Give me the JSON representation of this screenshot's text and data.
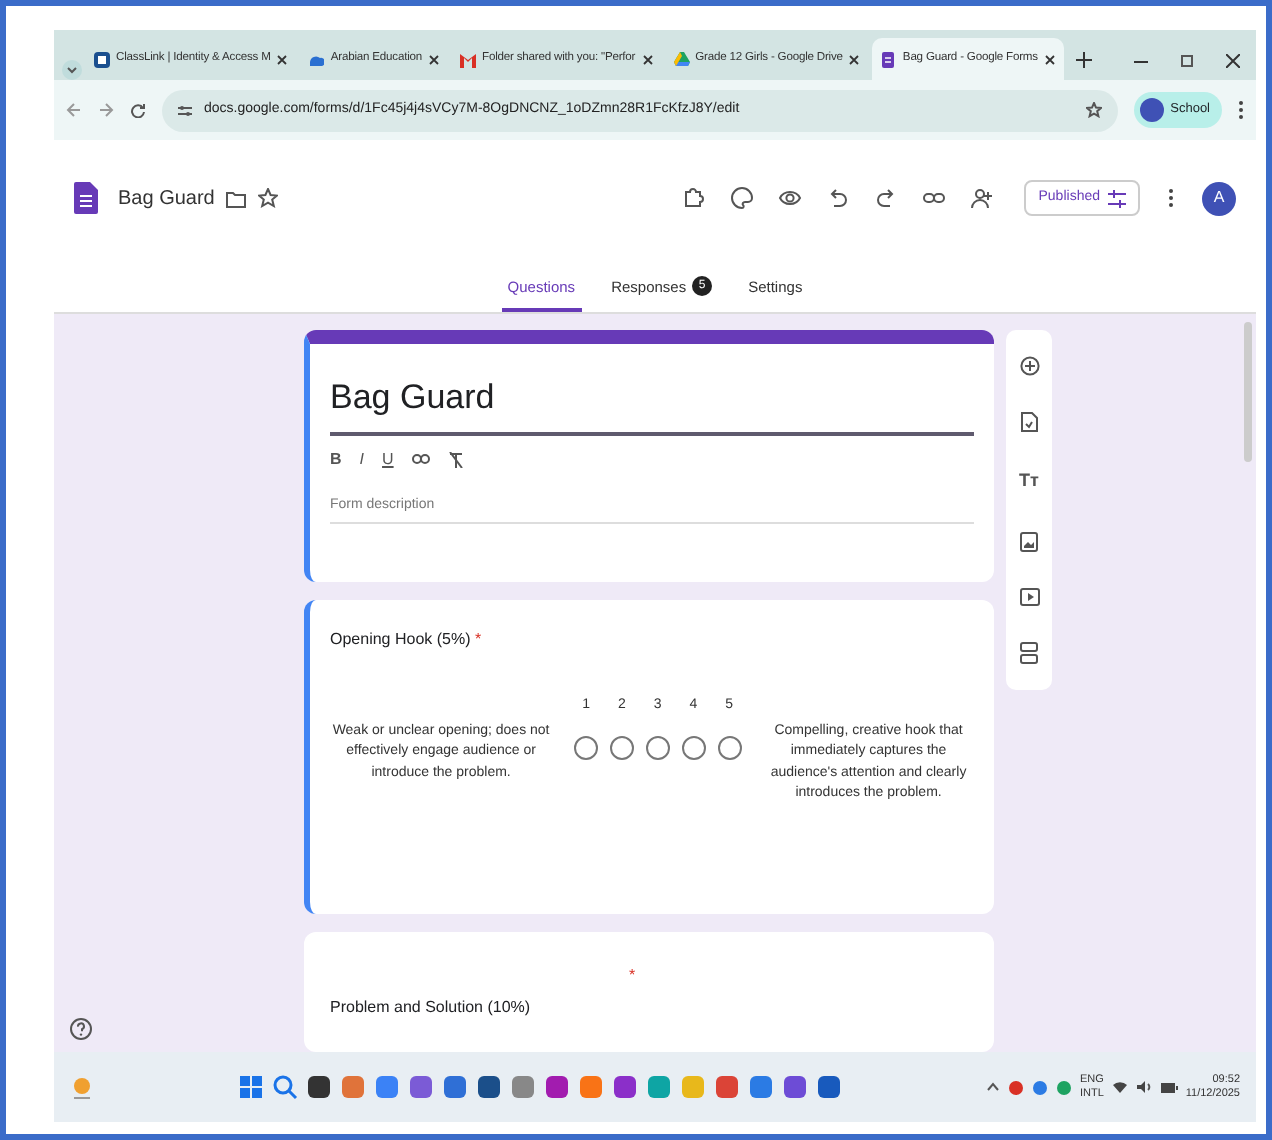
{
  "browser": {
    "tabs": [
      {
        "kind": "classlink",
        "title": "ClassLink | Identity & Access M",
        "selected": false
      },
      {
        "kind": "cloud",
        "title": "Arabian Education",
        "selected": false
      },
      {
        "kind": "mail",
        "title": "Folder shared with you: \"Perfor",
        "selected": false
      },
      {
        "kind": "drive",
        "title": "Grade 12 Girls - Google Drive",
        "selected": false
      },
      {
        "kind": "forms",
        "title": "Bag Guard - Google Forms",
        "selected": true
      }
    ],
    "url": "docs.google.com/forms/d/1Fc45j4j4sVCy7M-8OgDNCNZ_1oDZmn28R1FcKfzJ8Y/edit",
    "profile": "School"
  },
  "app_header": {
    "title": "Bag Guard",
    "publish_button": "Published",
    "avatar": "A"
  },
  "form_tabs": [
    {
      "label": "Questions",
      "selected": true
    },
    {
      "label": "Responses",
      "selected": false,
      "badge": "5"
    },
    {
      "label": "Settings",
      "selected": false
    }
  ],
  "form": {
    "title": "Bag Guard",
    "format_buttons": [
      "B",
      "I",
      "U"
    ],
    "description_placeholder": "Form description"
  },
  "side_toolbar": {
    "title_tool": "Tт"
  },
  "questions": [
    {
      "title": "Opening Hook (5%)",
      "required_mark": "*",
      "low_label": "Weak or unclear opening; does not effectively engage audience or introduce the problem.",
      "high_label": "Compelling, creative hook that immediately captures the audience's attention and clearly introduces the problem.",
      "scale": [
        {
          "label": "1",
          "selected": false
        },
        {
          "label": "2",
          "selected": false
        },
        {
          "label": "3",
          "selected": false
        },
        {
          "label": "4",
          "selected": false
        },
        {
          "label": "5",
          "selected": false
        }
      ]
    },
    {
      "title": "Problem and Solution (10%)",
      "required_mark": "*"
    }
  ],
  "taskbar": {
    "language": "ENG",
    "layout": "INTL",
    "time": "09:52",
    "date": "11/12/2025"
  }
}
